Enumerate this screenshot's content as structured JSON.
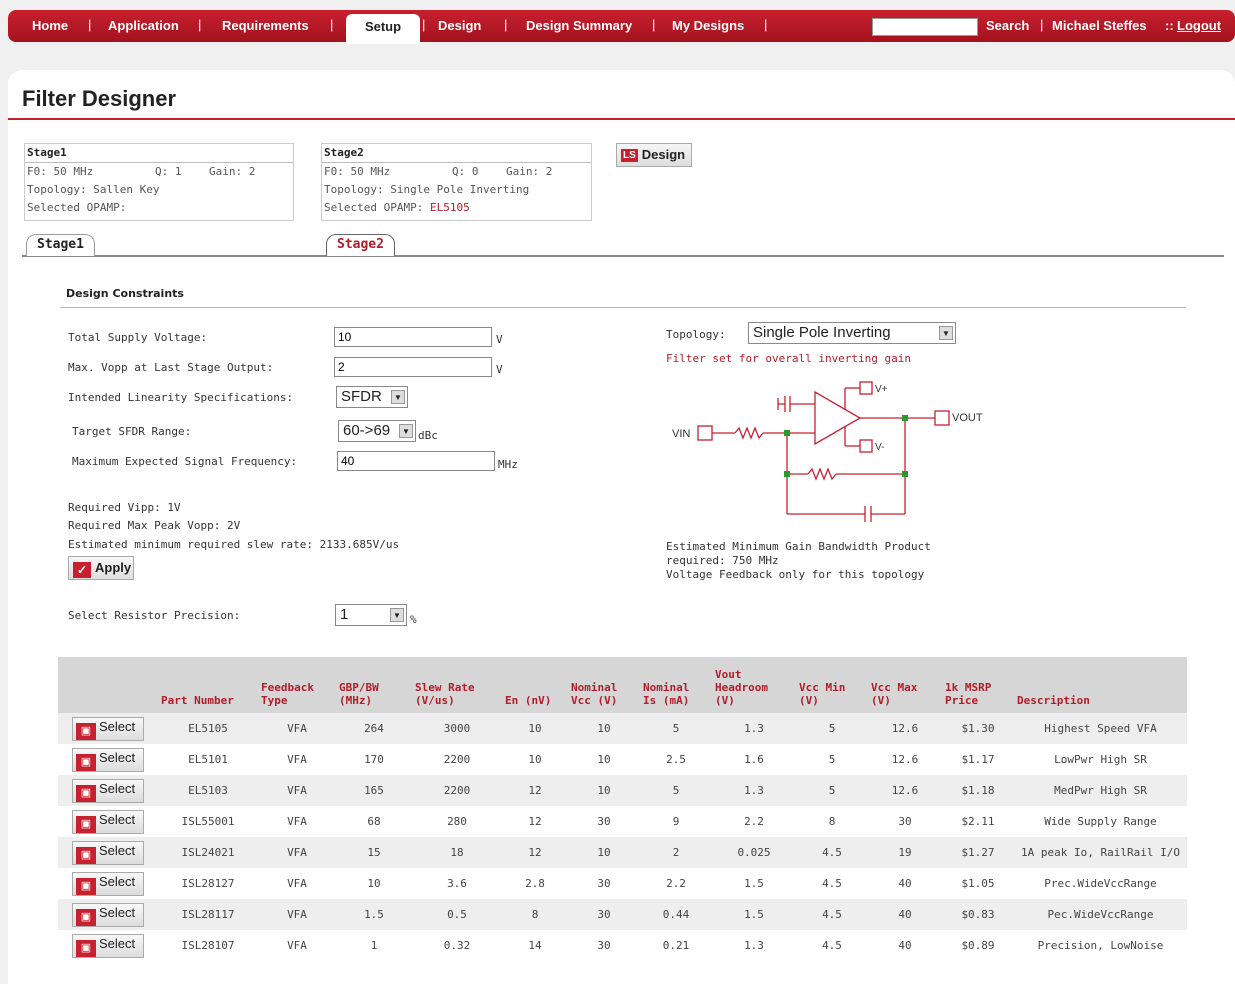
{
  "nav": {
    "items": [
      "Home",
      "Application",
      "Requirements",
      "Setup",
      "Design",
      "Design Summary",
      "My Designs"
    ],
    "active": "Setup",
    "search_label": "Search",
    "user": "Michael Steffes",
    "separator": "::",
    "logout": "Logout"
  },
  "page_title": "Filter Designer",
  "stages": [
    {
      "title": "Stage1",
      "f0": "F0: 50 MHz",
      "q": "Q: 1",
      "gain": "Gain: 2",
      "topology": "Topology: Sallen Key",
      "opamp_label": "Selected OPAMP:",
      "opamp": ""
    },
    {
      "title": "Stage2",
      "f0": "F0: 50 MHz",
      "q": "Q: 0",
      "gain": "Gain: 2",
      "topology": "Topology: Single Pole Inverting",
      "opamp_label": "Selected OPAMP:",
      "opamp": "EL5105"
    }
  ],
  "design_button": {
    "icon": "LS",
    "label": "Design"
  },
  "tabs": [
    "Stage1",
    "Stage2"
  ],
  "constraints": {
    "title": "Design Constraints",
    "supply_label": "Total Supply Voltage:",
    "supply_value": "10",
    "supply_unit": "V",
    "vopp_label": "Max. Vopp at Last Stage Output:",
    "vopp_value": "2",
    "vopp_unit": "V",
    "linearity_label": "Intended Linearity Specifications:",
    "linearity_value": "SFDR",
    "sfdr_label": "Target SFDR Range:",
    "sfdr_value": "60->69",
    "sfdr_unit": "dBc",
    "freq_label": "Maximum Expected Signal Frequency:",
    "freq_value": "40",
    "freq_unit": "MHz",
    "req_vipp": "Required Vipp: 1V",
    "req_vopp": "Required Max Peak Vopp: 2V",
    "slew": "Estimated minimum required slew rate: 2133.685V/us",
    "apply": "Apply",
    "precision_label": "Select Resistor Precision:",
    "precision_value": "1",
    "precision_unit": "%"
  },
  "topology": {
    "label": "Topology:",
    "value": "Single Pole Inverting",
    "note": "Filter set for overall inverting gain",
    "schematic": {
      "vin": "VIN",
      "vout": "VOUT",
      "vplus": "V+",
      "vminus": "V-"
    },
    "gbp_line1": "Estimated Minimum Gain Bandwidth Product",
    "gbp_line2": "required: 750 MHz",
    "vf_note": "Voltage Feedback only for this topology"
  },
  "table": {
    "select_label": "Select",
    "headers": [
      "",
      "Part Number",
      "Feedback Type",
      "GBP/BW (MHz)",
      "Slew Rate (V/us)",
      "En (nV)",
      "Nominal Vcc (V)",
      "Nominal Is (mA)",
      "Vout Headroom (V)",
      "Vcc Min (V)",
      "Vcc Max (V)",
      "1k MSRP Price",
      "Description"
    ],
    "rows": [
      [
        "EL5105",
        "VFA",
        "264",
        "3000",
        "10",
        "10",
        "5",
        "1.3",
        "5",
        "12.6",
        "$1.30",
        "Highest Speed VFA"
      ],
      [
        "EL5101",
        "VFA",
        "170",
        "2200",
        "10",
        "10",
        "2.5",
        "1.6",
        "5",
        "12.6",
        "$1.17",
        "LowPwr High SR"
      ],
      [
        "EL5103",
        "VFA",
        "165",
        "2200",
        "12",
        "10",
        "5",
        "1.3",
        "5",
        "12.6",
        "$1.18",
        "MedPwr High SR"
      ],
      [
        "ISL55001",
        "VFA",
        "68",
        "280",
        "12",
        "30",
        "9",
        "2.2",
        "8",
        "30",
        "$2.11",
        "Wide Supply Range"
      ],
      [
        "ISL24021",
        "VFA",
        "15",
        "18",
        "12",
        "10",
        "2",
        "0.025",
        "4.5",
        "19",
        "$1.27",
        "1A peak Io, RailRail I/O"
      ],
      [
        "ISL28127",
        "VFA",
        "10",
        "3.6",
        "2.8",
        "30",
        "2.2",
        "1.5",
        "4.5",
        "40",
        "$1.05",
        "Prec.WideVccRange"
      ],
      [
        "ISL28117",
        "VFA",
        "1.5",
        "0.5",
        "8",
        "30",
        "0.44",
        "1.5",
        "4.5",
        "40",
        "$0.83",
        "Pec.WideVccRange"
      ],
      [
        "ISL28107",
        "VFA",
        "1",
        "0.32",
        "14",
        "30",
        "0.21",
        "1.3",
        "4.5",
        "40",
        "$0.89",
        "Precision, LowNoise"
      ]
    ]
  }
}
